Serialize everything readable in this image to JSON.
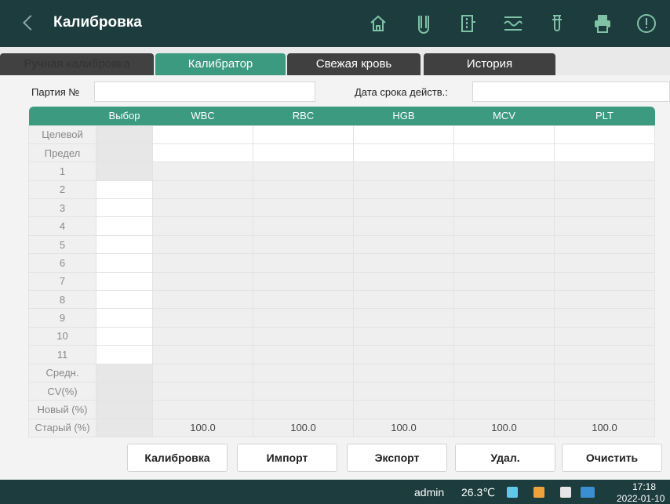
{
  "header": {
    "title": "Калибровка",
    "icons": [
      "back-icon",
      "home-icon",
      "test-tube-icon",
      "exit-door-icon",
      "waveform-icon",
      "reagent-tube-icon",
      "printer-icon",
      "alert-icon"
    ]
  },
  "tabs": [
    {
      "label": "Ручная калибровка",
      "state": "inactive"
    },
    {
      "label": "Калибратор",
      "state": "active"
    },
    {
      "label": "Свежая кровь",
      "state": "inactive"
    },
    {
      "label": "История",
      "state": "inactive"
    }
  ],
  "form": {
    "lot_label": "Партия №",
    "lot_value": "",
    "expiry_label": "Дата срока действ.:",
    "expiry_value": ""
  },
  "table": {
    "columns": [
      "",
      "Выбор",
      "WBC",
      "RBC",
      "HGB",
      "MCV",
      "PLT"
    ],
    "rows": [
      {
        "label": "Целевой",
        "values": [
          "",
          "",
          "",
          "",
          ""
        ]
      },
      {
        "label": "Предел",
        "values": [
          "",
          "",
          "",
          "",
          ""
        ]
      },
      {
        "label": "1",
        "values": [
          "",
          "",
          "",
          "",
          ""
        ]
      },
      {
        "label": "2",
        "values": [
          "",
          "",
          "",
          "",
          ""
        ]
      },
      {
        "label": "3",
        "values": [
          "",
          "",
          "",
          "",
          ""
        ]
      },
      {
        "label": "4",
        "values": [
          "",
          "",
          "",
          "",
          ""
        ]
      },
      {
        "label": "5",
        "values": [
          "",
          "",
          "",
          "",
          ""
        ]
      },
      {
        "label": "6",
        "values": [
          "",
          "",
          "",
          "",
          ""
        ]
      },
      {
        "label": "7",
        "values": [
          "",
          "",
          "",
          "",
          ""
        ]
      },
      {
        "label": "8",
        "values": [
          "",
          "",
          "",
          "",
          ""
        ]
      },
      {
        "label": "9",
        "values": [
          "",
          "",
          "",
          "",
          ""
        ]
      },
      {
        "label": "10",
        "values": [
          "",
          "",
          "",
          "",
          ""
        ]
      },
      {
        "label": "11",
        "values": [
          "",
          "",
          "",
          "",
          ""
        ]
      },
      {
        "label": "Средн.",
        "values": [
          "",
          "",
          "",
          "",
          ""
        ]
      },
      {
        "label": "CV(%)",
        "values": [
          "",
          "",
          "",
          "",
          ""
        ]
      },
      {
        "label": "Новый (%)",
        "values": [
          "",
          "",
          "",
          "",
          ""
        ]
      },
      {
        "label": "Старый (%)",
        "values": [
          "100.0",
          "100.0",
          "100.0",
          "100.0",
          "100.0"
        ]
      }
    ]
  },
  "buttons": {
    "calibrate": "Калибровка",
    "import": "Импорт",
    "export": "Экспорт",
    "delete": "Удал.",
    "clear": "Очистить"
  },
  "status": {
    "user": "admin",
    "temperature": "26.3℃",
    "time": "17:18",
    "date": "2022-01-10"
  },
  "colors": {
    "header_bg": "#1d3c3e",
    "accent": "#3b9a80",
    "alert": "#ff4d4f"
  }
}
